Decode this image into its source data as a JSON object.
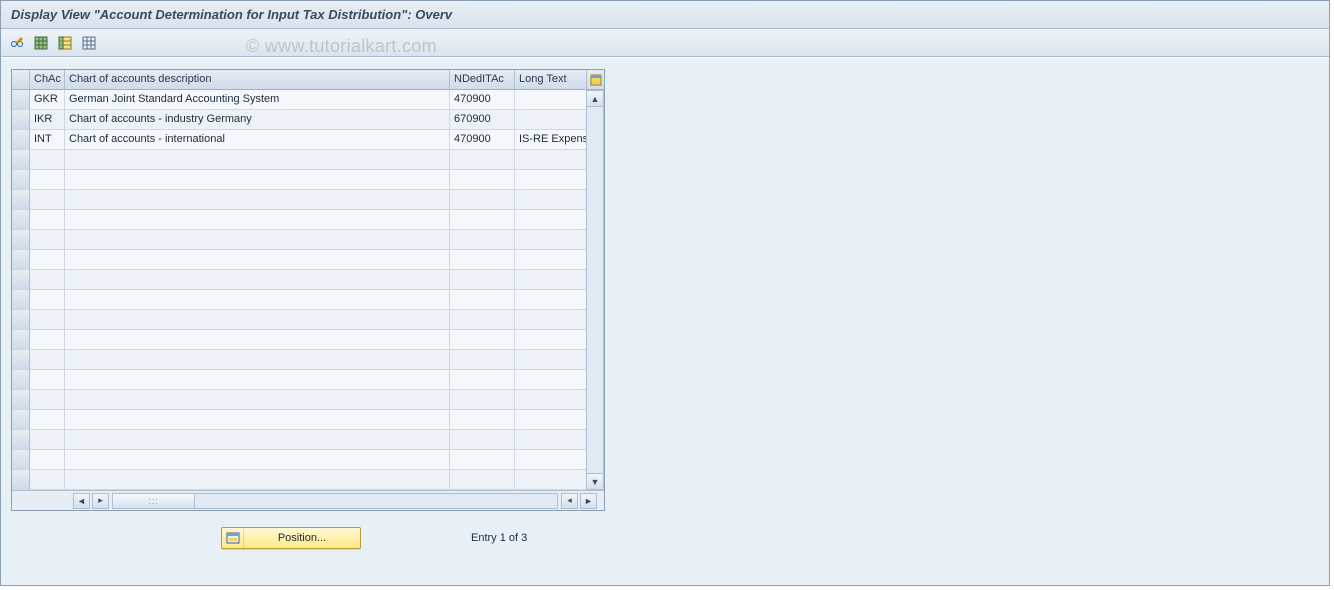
{
  "title": "Display View \"Account Determination for Input Tax Distribution\": Overv",
  "watermark": "© www.tutorialkart.com",
  "toolbar": {
    "btn1": "change-display-toggle",
    "btn2": "select-all",
    "btn3": "deselect-all",
    "btn4": "table-settings"
  },
  "table": {
    "headers": {
      "sel": "",
      "chac": "ChAc",
      "desc": "Chart of accounts description",
      "nded": "NDedITAc",
      "long": "Long Text"
    },
    "rows": [
      {
        "chac": "GKR",
        "desc": "German Joint Standard Accounting System",
        "nded": "470900",
        "long": ""
      },
      {
        "chac": "IKR",
        "desc": "Chart of accounts - industry Germany",
        "nded": "670900",
        "long": ""
      },
      {
        "chac": "INT",
        "desc": "Chart of accounts - international",
        "nded": "470900",
        "long": "IS-RE Expenses"
      }
    ],
    "emptyRows": 17
  },
  "footer": {
    "position_label": "Position...",
    "entry_text": "Entry 1 of 3"
  }
}
